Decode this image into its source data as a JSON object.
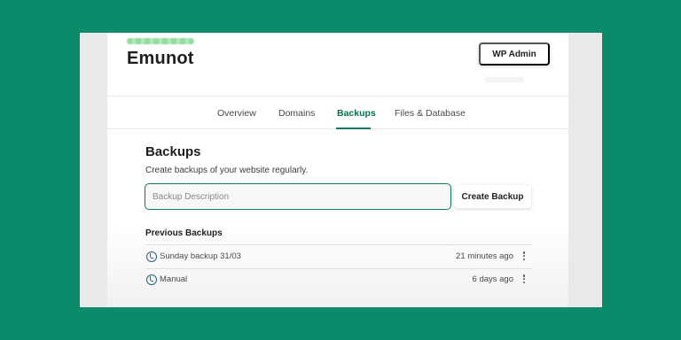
{
  "header": {
    "site_title": "Emunot",
    "wp_admin_label": "WP Admin"
  },
  "tabs": [
    {
      "label": "Overview",
      "active": false
    },
    {
      "label": "Domains",
      "active": false
    },
    {
      "label": "Backups",
      "active": true
    },
    {
      "label": "Files & Database",
      "active": false
    }
  ],
  "backups": {
    "title": "Backups",
    "subtitle": "Create backups of your website regularly.",
    "description_placeholder": "Backup Description",
    "description_value": "",
    "create_label": "Create Backup",
    "previous_title": "Previous Backups",
    "items": [
      {
        "name": "Sunday backup 31/03",
        "time": "21 minutes ago",
        "icon": "backup-restore-icon"
      },
      {
        "name": "Manual",
        "time": "6 days ago",
        "icon": "backup-restore-icon"
      }
    ]
  },
  "colors": {
    "background": "#0b8a6c",
    "accent": "#0b7e61",
    "card": "#ffffff"
  }
}
